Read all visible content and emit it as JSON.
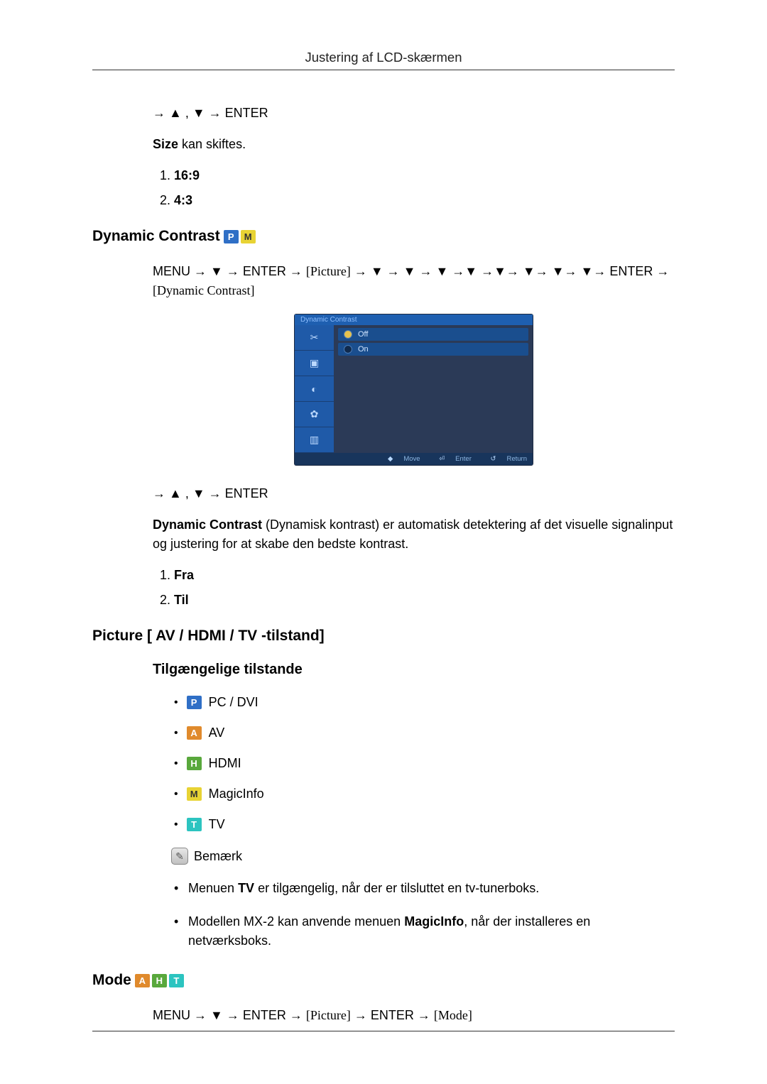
{
  "header": {
    "title": "Justering af LCD-skærmen"
  },
  "size_section": {
    "nav": "→ ▲ , ▼ → ENTER",
    "text_lead": "Size",
    "text_rest": " kan skiftes.",
    "items": [
      "16:9",
      "4:3"
    ]
  },
  "dynamic_contrast": {
    "title": "Dynamic Contrast",
    "badges": [
      "P",
      "M"
    ],
    "path": {
      "pre": "MENU → ▼ → ENTER → ",
      "pic": "[Picture]",
      "mid": " → ▼ → ▼ → ▼ →▼ →▼→ ▼→ ▼→ ▼→ ENTER → ",
      "tail": "[Dynamic Contrast]"
    },
    "osd": {
      "title": "Dynamic Contrast",
      "options": [
        {
          "label": "Off",
          "selected": true
        },
        {
          "label": "On",
          "selected": false
        }
      ],
      "footer": {
        "move": "Move",
        "enter": "Enter",
        "return": "Return"
      }
    },
    "nav2": "→ ▲ , ▼ → ENTER",
    "desc_lead": "Dynamic Contrast",
    "desc_rest": " (Dynamisk kontrast) er automatisk detektering af det visuelle signalinput og justering for at skabe den bedste kontrast.",
    "items": [
      "Fra",
      "Til"
    ]
  },
  "picture_av": {
    "title": "Picture [ AV / HDMI / TV -tilstand]",
    "subtitle": "Tilgængelige tilstande",
    "modes": [
      {
        "badge": "P",
        "label": "PC / DVI"
      },
      {
        "badge": "A",
        "label": "AV"
      },
      {
        "badge": "H",
        "label": "HDMI"
      },
      {
        "badge": "M",
        "label": "MagicInfo"
      },
      {
        "badge": "T",
        "label": "TV"
      }
    ],
    "note_label": "Bemærk",
    "notes": [
      {
        "pre": "Menuen ",
        "b1": "TV",
        "mid": " er tilgængelig, når der er tilsluttet en tv-tunerboks.",
        "b2": "",
        "post": ""
      },
      {
        "pre": "Modellen MX-2 kan anvende menuen ",
        "b1": "MagicInfo",
        "mid": ", når der installeres en netværksboks.",
        "b2": "",
        "post": ""
      }
    ]
  },
  "mode_section": {
    "title": "Mode",
    "badges": [
      "A",
      "H",
      "T"
    ],
    "path": {
      "pre": "MENU → ▼ → ENTER → ",
      "pic": "[Picture]",
      "mid": " → ENTER → ",
      "tail": "[Mode]"
    }
  }
}
